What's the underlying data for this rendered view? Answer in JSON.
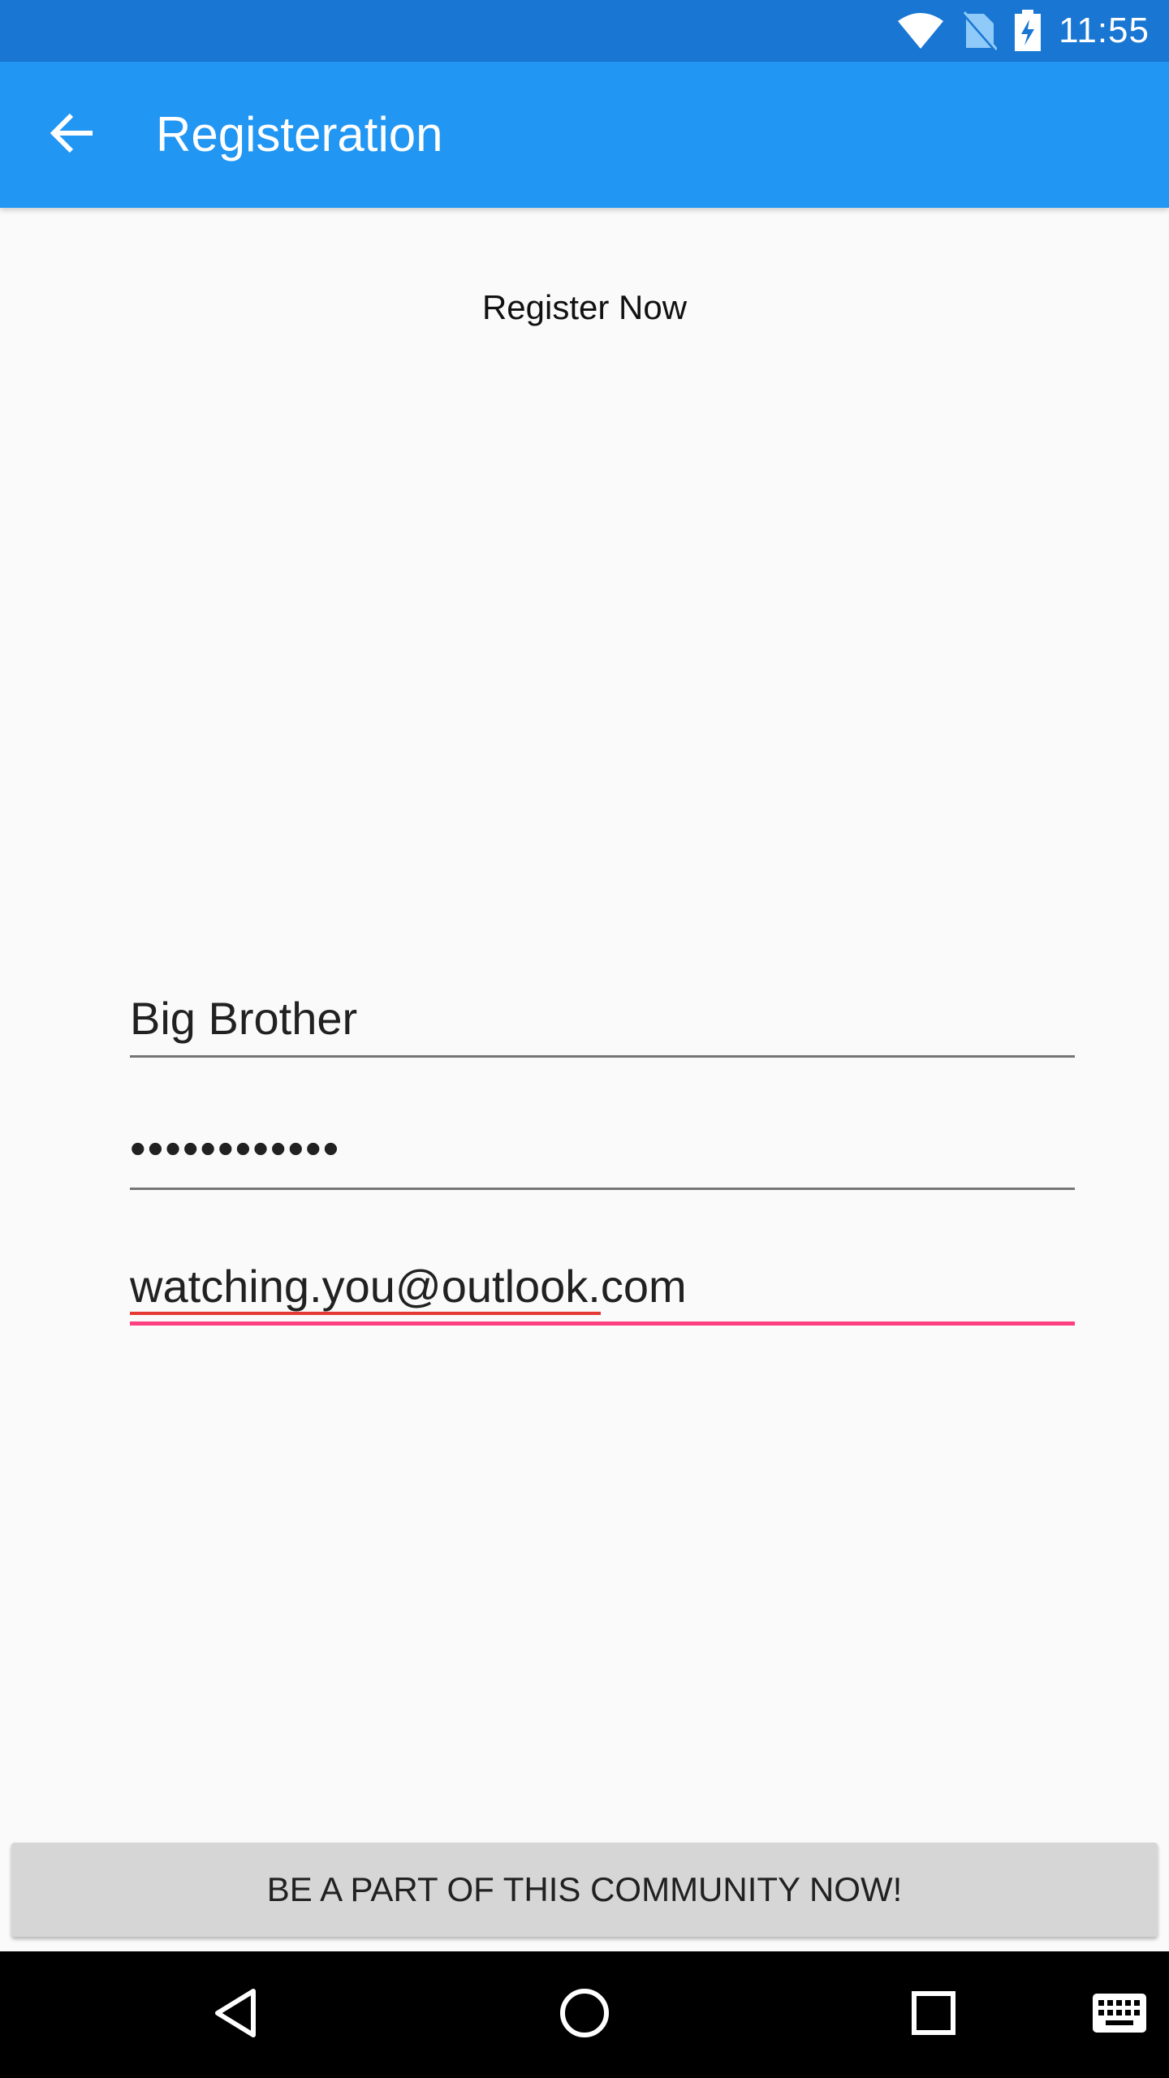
{
  "status_bar": {
    "time": "11:55",
    "icons": [
      "wifi-icon",
      "no-sim-icon",
      "battery-charging-icon"
    ]
  },
  "app_bar": {
    "title": "Registeration",
    "back_icon": "arrow-back-icon"
  },
  "form": {
    "heading": "Register Now",
    "name_value": "Big Brother",
    "password_value": "••••••••••••",
    "email_value": "watching.you@outlook.com",
    "email_misspelled_part": "watching.you@outlook",
    "email_rest": ".com"
  },
  "actions": {
    "community_button_label": "BE A PART OF THIS COMMUNITY NOW!"
  },
  "nav_bar": {
    "icons": [
      "back-triangle-icon",
      "home-circle-icon",
      "recents-square-icon",
      "keyboard-icon"
    ]
  },
  "colors": {
    "status_bar": "#1976d2",
    "app_bar": "#2196f3",
    "accent": "#ff4081",
    "spellcheck": "#e53935",
    "button": "#d6d6d6"
  }
}
